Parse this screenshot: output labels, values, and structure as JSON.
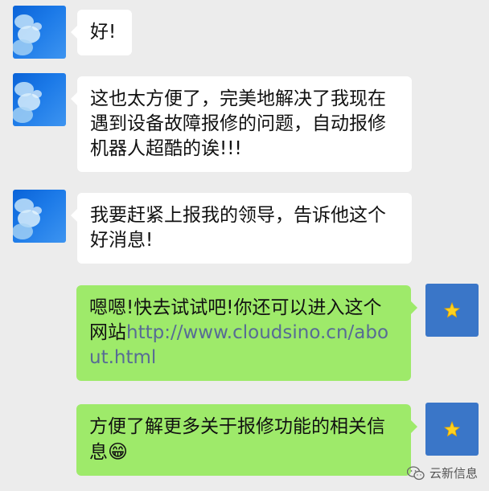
{
  "messages": [
    {
      "text": "好!"
    },
    {
      "text": "这也太方便了，完美地解决了我现在遇到设备故障报修的问题，自动报修机器人超酷的诶!!!"
    },
    {
      "text": "我要赶紧上报我的领导，告诉他这个好消息!"
    },
    {
      "text_prefix": "嗯嗯!快去试试吧!你还可以进入这个网站",
      "link": "http://www.cloudsino.cn/about.html"
    },
    {
      "text": "方便了解更多关于报修功能的相关信息",
      "emoji": "😁"
    }
  ],
  "watermark": {
    "label": "云新信息",
    "icon": "wechat-icon"
  },
  "colors": {
    "background": "#ececec",
    "incoming_bubble": "#ffffff",
    "outgoing_bubble": "#9eea6a",
    "link": "#576b95"
  }
}
